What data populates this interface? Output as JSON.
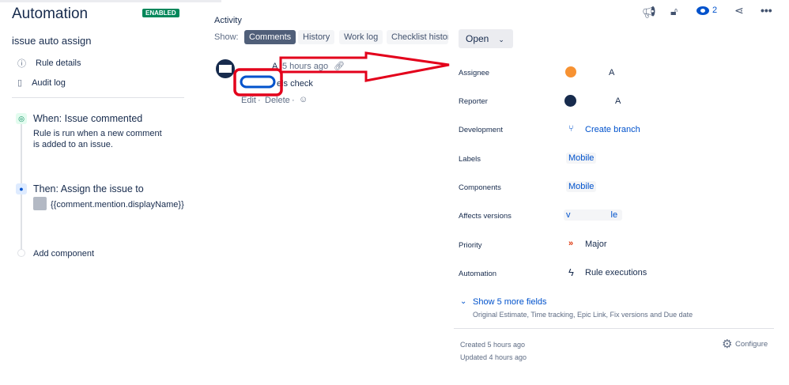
{
  "left": {
    "title": "Automation",
    "status": "ENABLED",
    "rule_name": "issue auto assign",
    "nav": [
      {
        "label": "Rule details",
        "icon": "info-icon"
      },
      {
        "label": "Audit log",
        "icon": "document-icon"
      }
    ],
    "trigger": {
      "title": "When: Issue commented",
      "desc": "Rule is run when a new comment is added to an issue."
    },
    "action": {
      "title": "Then: Assign the issue to",
      "value": "{{comment.mention.displayName}}"
    },
    "add": "Add component"
  },
  "activity": {
    "heading": "Activity",
    "show": "Show:",
    "tabs": [
      "Comments",
      "History",
      "Work log",
      "Checklist histor"
    ],
    "comment": {
      "author_suffix": "A",
      "time": "5 hours ago",
      "text": "els check",
      "edit": "Edit",
      "delete": "Delete"
    }
  },
  "status_button": "Open",
  "watchers": "2",
  "fields": [
    {
      "label": "Assignee",
      "value": "A"
    },
    {
      "label": "Reporter",
      "value": "A"
    },
    {
      "label": "Development",
      "value": "Create branch"
    },
    {
      "label": "Labels",
      "value": "Mobile"
    },
    {
      "label": "Components",
      "value": "Mobile"
    },
    {
      "label": "Affects versions",
      "value": "v le"
    },
    {
      "label": "Priority",
      "value": "Major"
    },
    {
      "label": "Automation",
      "value": "Rule executions"
    }
  ],
  "more": {
    "label": "Show 5 more fields",
    "desc": "Original Estimate, Time tracking, Epic Link, Fix versions and Due date"
  },
  "meta": {
    "created": "Created 5 hours ago",
    "updated": "Updated 4 hours ago",
    "configure": "Configure"
  },
  "colors": {
    "accent": "#0052cc",
    "enabled": "#00875a",
    "annotation": "#e3001b"
  }
}
